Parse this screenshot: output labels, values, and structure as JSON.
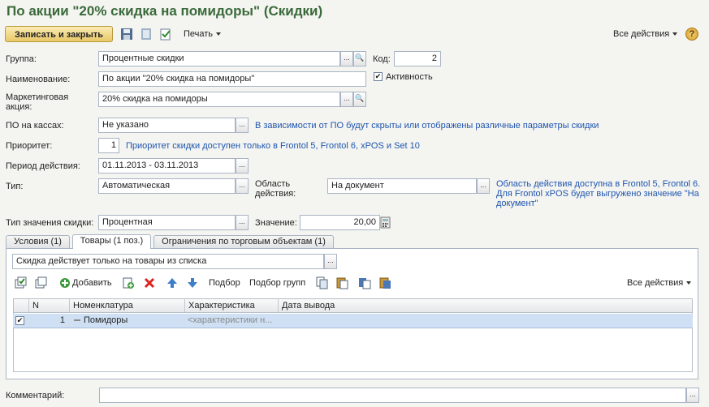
{
  "window": {
    "title": "По акции \"20% скидка на помидоры\" (Скидки)"
  },
  "toolbar": {
    "save_close": "Записать и закрыть",
    "print": "Печать",
    "all_actions": "Все действия",
    "help": "?"
  },
  "form": {
    "group_label": "Группа:",
    "group_value": "Процентные скидки",
    "code_label": "Код:",
    "code_value": "2",
    "name_label": "Наименование:",
    "name_value": "По акции \"20% скидка на помидоры\"",
    "active_label": "Активность",
    "marketing_label_1": "Маркетинговая",
    "marketing_label_2": "акция:",
    "marketing_value": "20% скидка на помидоры",
    "pos_label": "ПО на кассах:",
    "pos_value": "Не указано",
    "pos_hint": "В зависимости от ПО будут скрыты или отображены различные параметры скидки",
    "priority_label": "Приоритет:",
    "priority_value": "1",
    "priority_hint": "Приоритет скидки доступен только в Frontol 5, Frontol 6, xPOS и Set 10",
    "period_label": "Период действия:",
    "period_value": "01.11.2013 - 03.11.2013",
    "type_label": "Тип:",
    "type_value": "Автоматическая",
    "scope_label_1": "Область",
    "scope_label_2": "действия:",
    "scope_value": "На документ",
    "scope_hint_1": "Область действия доступна в Frontol 5, Frontol 6.",
    "scope_hint_2": "Для Frontol xPOS будет выгружено значение \"На",
    "scope_hint_3": "документ\"",
    "value_type_label": "Тип значения скидки:",
    "value_type_value": "Процентная",
    "value_label": "Значение:",
    "value_value": "20,00",
    "comment_label": "Комментарий:",
    "comment_value": ""
  },
  "tabs": [
    {
      "label": "Условия (1)"
    },
    {
      "label": "Товары (1 поз.)"
    },
    {
      "label": "Ограничения по торговым объектам (1)"
    }
  ],
  "goods": {
    "mode_value": "Скидка действует только на товары из списка",
    "add_label": "Добавить",
    "select_label": "Подбор",
    "select_groups_label": "Подбор групп",
    "all_actions": "Все действия",
    "columns": [
      "N",
      "Номенклатура",
      "Характеристика",
      "Дата вывода"
    ],
    "rows": [
      {
        "checked": true,
        "n": "1",
        "item": "Помидоры",
        "characteristic": "<характеристики н...",
        "date": ""
      }
    ]
  },
  "colors": {
    "title": "#3a6a3a",
    "hint": "#1f56b0",
    "row_selected": "#cfe0f4"
  }
}
